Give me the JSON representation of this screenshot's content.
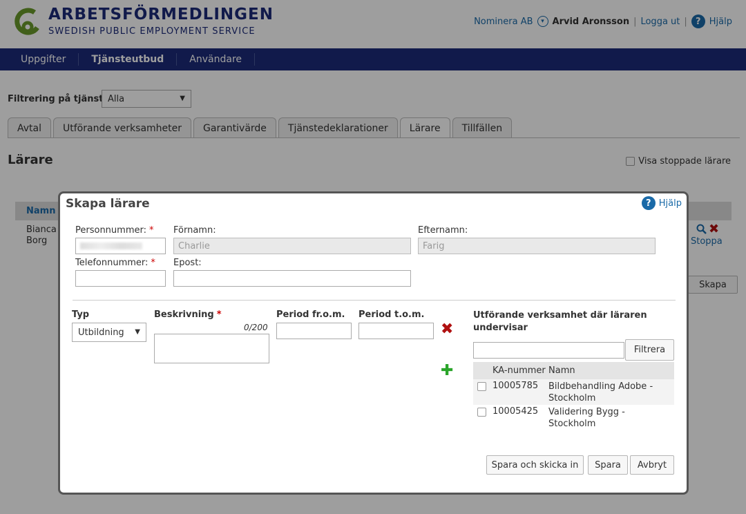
{
  "header": {
    "title": "ARBETSFÖRMEDLINGEN",
    "subtitle": "SWEDISH PUBLIC EMPLOYMENT SERVICE",
    "org": "Nominera AB",
    "user": "Arvid Aronsson",
    "logout": "Logga ut",
    "help": "Hjälp"
  },
  "nav": {
    "items": [
      "Uppgifter",
      "Tjänsteutbud",
      "Användare"
    ],
    "active": "Tjänsteutbud"
  },
  "filter": {
    "label": "Filtrering på tjänst",
    "value": "Alla"
  },
  "tabs": [
    "Avtal",
    "Utförande verksamheter",
    "Garantivärde",
    "Tjänstedeklarationer",
    "Lärare",
    "Tillfällen"
  ],
  "active_tab": "Lärare",
  "page": {
    "title": "Lärare",
    "show_stopped": "Visa stoppade lärare",
    "column_name": "Namn",
    "row_name_line1": "Bianca",
    "row_name_line2": "Borg",
    "row_action": "Stoppa",
    "create_button": "Skapa"
  },
  "modal": {
    "title": "Skapa lärare",
    "help": "Hjälp",
    "personnummer_label": "Personnummer:",
    "fornamn_label": "Förnamn:",
    "fornamn_value": "Charlie",
    "efternamn_label": "Efternamn:",
    "efternamn_value": "Farig",
    "telefon_label": "Telefonnummer:",
    "epost_label": "Epost:",
    "required_mark": "*",
    "typ_label": "Typ",
    "typ_value": "Utbildning",
    "beskrivning_label": "Beskrivning",
    "beskrivning_counter": "0/200",
    "period_from_label": "Period fr.o.m.",
    "period_tom_label": "Period t.o.m.",
    "utforande_label_line1": "Utförande verksamhet där läraren",
    "utforande_label_line2": "undervisar",
    "filter_button": "Filtrera",
    "ka_header": "KA-nummer",
    "name_header": "Namn",
    "rows": [
      {
        "ka": "10005785",
        "name_line1": "Bildbehandling Adobe -",
        "name_line2": "Stockholm"
      },
      {
        "ka": "10005425",
        "name_line1": "Validering Bygg - Stockholm",
        "name_line2": ""
      }
    ],
    "buttons": {
      "save_submit": "Spara och skicka in",
      "save": "Spara",
      "cancel": "Avbryt"
    }
  },
  "icons": {
    "logo": "arbetsformedlingen-logo",
    "dropdown": "chevron-down-icon",
    "help": "help-icon",
    "search": "magnifier-icon",
    "delete": "red-x-icon",
    "add": "green-plus-icon"
  },
  "colors": {
    "brand_navy": "#1c2b7a",
    "logo_green": "#6a9a2a",
    "link_blue": "#1a6aa8",
    "delete_red": "#b01010",
    "add_green": "#2aa52a"
  }
}
